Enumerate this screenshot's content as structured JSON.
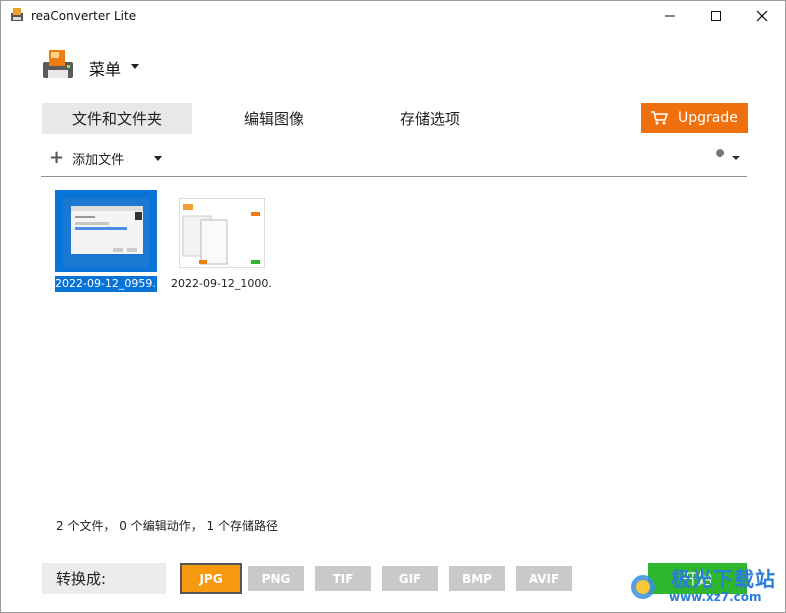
{
  "window": {
    "title": "reaConverter Lite"
  },
  "menu": {
    "label": "菜单"
  },
  "tabs": [
    {
      "label": "文件和文件夹",
      "active": true
    },
    {
      "label": "编辑图像",
      "active": false
    },
    {
      "label": "存储选项",
      "active": false
    }
  ],
  "upgrade": {
    "label": "Upgrade",
    "color": "#f0700e"
  },
  "toolbar": {
    "add_files_label": "添加文件"
  },
  "files": [
    {
      "name": "2022-09-12_0959...",
      "selected": true
    },
    {
      "name": "2022-09-12_1000...",
      "selected": false
    }
  ],
  "status": {
    "text": "2 个文件， 0 个编辑动作， 1 个存储路径"
  },
  "convert": {
    "label": "转换成:",
    "formats": [
      {
        "label": "JPG",
        "active": true
      },
      {
        "label": "PNG",
        "active": false
      },
      {
        "label": "TIF",
        "active": false
      },
      {
        "label": "GIF",
        "active": false
      },
      {
        "label": "BMP",
        "active": false
      },
      {
        "label": "AVIF",
        "active": false
      }
    ],
    "start_label": "开始"
  },
  "watermark": {
    "text": "极光下载站",
    "url": "www.xz7.com"
  },
  "colors": {
    "accent": "#f0700e",
    "selection": "#0a73d8",
    "start": "#2fb62f",
    "format_active": "#f79a10"
  }
}
